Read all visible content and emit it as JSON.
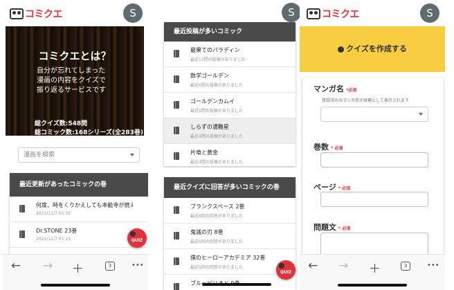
{
  "app": {
    "logo_text": "コミクエ",
    "avatar_letter": "S"
  },
  "screen1": {
    "hero_title": "コミクエとは？",
    "hero_desc": "自分が忘れてしまった\n漫画の内容をクイズで\n振り返るサービスです",
    "stat_quizzes": "総クイズ数:548問",
    "stat_comics": "総コミック数:168シリーズ(全283巻)",
    "search_placeholder": "漫画を検索",
    "recent_card_title": "最近更新があったコミックの巻",
    "recent_items": [
      {
        "title": "何度、時をくりかえしても本能寺が燃え…",
        "sub": "2021/11/7 01:55"
      },
      {
        "title": "Dr.STONE 23巻",
        "sub": "2021/11/7 01:13"
      }
    ],
    "fab_label": "QUIZ"
  },
  "screen2": {
    "posted_card_title": "最近投稿が多いコミック",
    "posted_items": [
      {
        "title": "最果てのパラディン",
        "sub": "最近13問の投稿がありました"
      },
      {
        "title": "数学ゴールデン",
        "sub": "最近6問の投稿がありました"
      },
      {
        "title": "ゴールデンカムイ",
        "sub": "最近5問の投稿がありました"
      },
      {
        "title": "しらずの濃難星",
        "sub": "最近4問の投稿がありました"
      },
      {
        "title": "片喰と黄金",
        "sub": "最近4問の投稿がありました"
      }
    ],
    "answered_card_title": "最近クイズに回答が多いコミックの巻",
    "answered_items": [
      {
        "title": "ブランクスペース 2巻",
        "sub": "最近8回の回答がありました"
      },
      {
        "title": "鬼滅の刃 8巻",
        "sub": "最近6回の回答がありました"
      },
      {
        "title": "僕のヒーローアカデミア 32巻",
        "sub": "最近5回の回答がありました"
      },
      {
        "title": "ブルーピリオド 9巻",
        "sub": ""
      }
    ],
    "fab_label": "QUIZ"
  },
  "screen3": {
    "banner": "クイズを作成する",
    "manga_label": "マンガ名",
    "required": "必須",
    "manga_help": "登録済みのマンガ名が候補として表示されます",
    "volume_label": "巻数",
    "page_label": "ページ",
    "question_label": "問題文"
  },
  "toolbar": {
    "back": "←",
    "forward": "→",
    "new_tab": "＋",
    "tabs_count": "3",
    "more": "•••"
  }
}
